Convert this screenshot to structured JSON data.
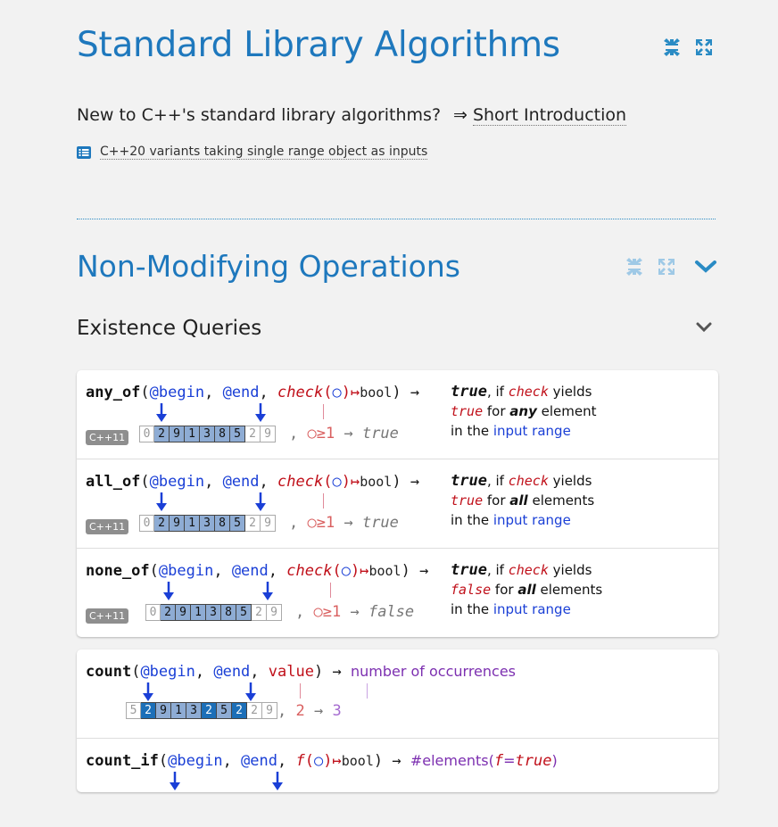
{
  "title": "Standard Library Algorithms",
  "intro": {
    "text": "New to C++'s standard library algorithms?",
    "arrow": "⇒",
    "link": "Short Introduction"
  },
  "variants": {
    "text": "C++20 variants taking single range object as inputs"
  },
  "section": {
    "title": "Non-Modifying Operations"
  },
  "subsection": {
    "title": "Existence Queries"
  },
  "badge": "C++11",
  "range_cells": [
    "0",
    "2",
    "9",
    "1",
    "3",
    "8",
    "5",
    "2",
    "9"
  ],
  "count_cells": [
    "5",
    "2",
    "9",
    "1",
    "3",
    "2",
    "5",
    "2",
    "2",
    "9"
  ],
  "sig_common": {
    "open": "(",
    "begin": "@begin",
    "comma": ", ",
    "end": "@end",
    "check": "check",
    "circle": "(○)",
    "mapsto": "↦",
    "bool": "bool",
    "close": ")",
    "arrow": "→"
  },
  "rows": [
    {
      "fname": "any_of",
      "pred": "○≥1",
      "result": "true",
      "desc": {
        "val": "true",
        "if": ", if ",
        "check": "check",
        "yields": " yields",
        "l2a": "true",
        "l2b": " for ",
        "quant": "any",
        "l2c": " element",
        "l3a": "in the ",
        "l3b": "input range"
      }
    },
    {
      "fname": "all_of",
      "pred": "○≥1",
      "result": "true",
      "desc": {
        "val": "true",
        "if": ", if ",
        "check": "check",
        "yields": " yields",
        "l2a": "true",
        "l2b": " for ",
        "quant": "all",
        "l2c": " elements",
        "l3a": "in the ",
        "l3b": "input range"
      }
    },
    {
      "fname": "none_of",
      "pred": "○≥1",
      "result": "false",
      "desc": {
        "val": "true",
        "if": ", if ",
        "check": "check",
        "yields": " yields",
        "l2a": "false",
        "l2b": " for ",
        "quant": "all",
        "l2c": " elements",
        "l3a": "in the ",
        "l3b": "input range"
      }
    }
  ],
  "count": {
    "fname": "count",
    "value": "value",
    "result_label": "number of occurrences",
    "arg": "2",
    "answer": "3"
  },
  "count_if": {
    "fname": "count_if",
    "f": "f",
    "result_label": "#elements(",
    "result_f": "f",
    "result_eq": "=",
    "result_true": "true",
    "result_close": ")"
  },
  "colors": {
    "accent": "#1e78bd",
    "param": "#1a3fd6",
    "check": "#c0101a",
    "result": "#7c2fb0"
  }
}
